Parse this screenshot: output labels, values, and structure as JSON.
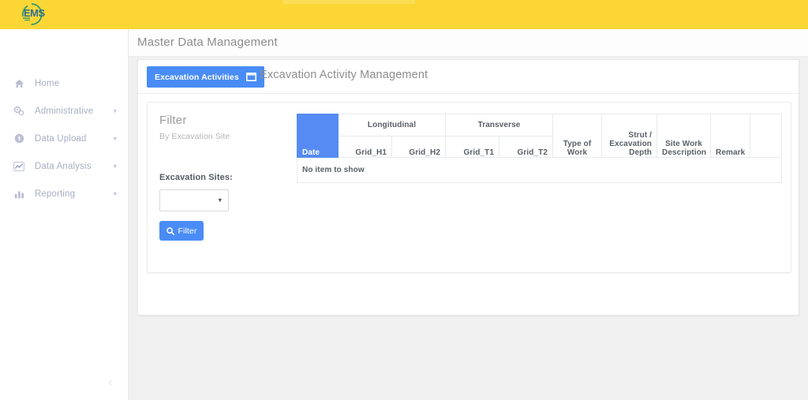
{
  "brand": {
    "logo_text": "EMS",
    "bar_color": "#fcd635",
    "accent_color": "#4a8cf5"
  },
  "sidebar": {
    "items": [
      {
        "label": "Home",
        "icon": "home-icon",
        "has_caret": false
      },
      {
        "label": "Administrative",
        "icon": "cogs-icon",
        "has_caret": true
      },
      {
        "label": "Data Upload",
        "icon": "upload-globe-icon",
        "has_caret": true
      },
      {
        "label": "Data Analysis",
        "icon": "chart-line-icon",
        "has_caret": true
      },
      {
        "label": "Reporting",
        "icon": "bar-chart-icon",
        "has_caret": true
      }
    ],
    "collapse_glyph": "‹"
  },
  "header": {
    "title": "Master Data Management"
  },
  "tabs": {
    "active": {
      "label": "Excavation Activities",
      "icon": "table-window-icon"
    },
    "section_title": "Excavation Activity Management"
  },
  "filter": {
    "heading": "Filter",
    "subheading": "By Excavation Site",
    "sites_label": "Excavation Sites:",
    "sites_value": "",
    "sites_placeholder": "",
    "button_label": "Filter",
    "button_icon": "search-icon",
    "caret_glyph": "▾"
  },
  "table": {
    "group_headers": [
      {
        "label": "Longitudinal",
        "span": 2
      },
      {
        "label": "Transverse",
        "span": 2
      }
    ],
    "date_header": "Date",
    "sub_headers": [
      "Grid_H1",
      "Grid_H2",
      "Grid_T1",
      "Grid_T2"
    ],
    "tall_headers": [
      "Type of Work",
      "Strut / Excavation Depth",
      "Site Work Description",
      "Remark",
      ""
    ],
    "rows": [],
    "empty_message": "No item to show"
  }
}
